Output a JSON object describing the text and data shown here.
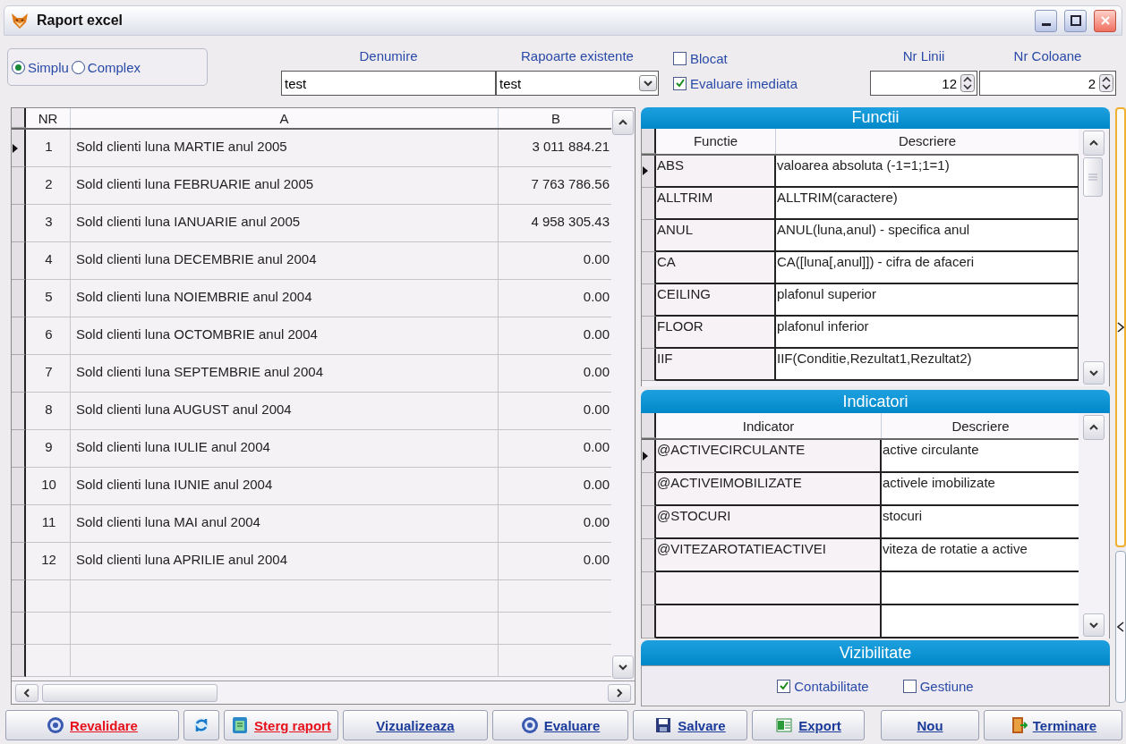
{
  "window": {
    "title": "Raport excel"
  },
  "mode": [
    {
      "label": "Simplu",
      "selected": true
    },
    {
      "label": "Complex",
      "selected": false
    }
  ],
  "fields": [
    {
      "label": "Denumire",
      "value": "test",
      "kind": "text"
    },
    {
      "label": "Rapoarte existente",
      "value": "test",
      "kind": "combo"
    }
  ],
  "options": [
    {
      "label": "Blocat",
      "checked": false
    },
    {
      "label": "Evaluare imediata",
      "checked": true
    }
  ],
  "spinners": [
    {
      "label": "Nr Linii",
      "value": "12"
    },
    {
      "label": "Nr Coloane",
      "value": "2"
    }
  ],
  "report_grid": {
    "columns": [
      "NR",
      "A",
      "B"
    ],
    "rows": [
      {
        "cells": [
          "1",
          "Sold clienti luna MARTIE anul 2005",
          "3 011 884.21"
        ],
        "current": true
      },
      {
        "cells": [
          "2",
          "Sold clienti luna FEBRUARIE anul 2005",
          "7 763 786.56"
        ],
        "current": false
      },
      {
        "cells": [
          "3",
          "Sold clienti luna IANUARIE anul 2005",
          "4 958 305.43"
        ],
        "current": false
      },
      {
        "cells": [
          "4",
          "Sold clienti luna DECEMBRIE anul 2004",
          "0.00"
        ],
        "current": false
      },
      {
        "cells": [
          "5",
          "Sold clienti luna NOIEMBRIE anul 2004",
          "0.00"
        ],
        "current": false
      },
      {
        "cells": [
          "6",
          "Sold clienti luna OCTOMBRIE anul 2004",
          "0.00"
        ],
        "current": false
      },
      {
        "cells": [
          "7",
          "Sold clienti luna SEPTEMBRIE anul 2004",
          "0.00"
        ],
        "current": false
      },
      {
        "cells": [
          "8",
          "Sold clienti luna AUGUST anul 2004",
          "0.00"
        ],
        "current": false
      },
      {
        "cells": [
          "9",
          "Sold clienti luna IULIE anul 2004",
          "0.00"
        ],
        "current": false
      },
      {
        "cells": [
          "10",
          "Sold clienti luna IUNIE anul 2004",
          "0.00"
        ],
        "current": false
      },
      {
        "cells": [
          "11",
          "Sold clienti luna MAI anul 2004",
          "0.00"
        ],
        "current": false
      },
      {
        "cells": [
          "12",
          "Sold clienti luna APRILIE anul 2004",
          "0.00"
        ],
        "current": false
      }
    ]
  },
  "functions": {
    "title": "Functii",
    "columns": [
      "Functie",
      "Descriere"
    ],
    "rows": [
      {
        "cells": [
          "ABS",
          "valoarea absoluta (-1=1;1=1)"
        ],
        "current": true
      },
      {
        "cells": [
          "ALLTRIM",
          "ALLTRIM(caractere)"
        ],
        "current": false
      },
      {
        "cells": [
          "ANUL",
          "ANUL(luna,anul) - specifica anul"
        ],
        "current": false
      },
      {
        "cells": [
          "CA",
          "CA([luna[,anul]]) - cifra de afaceri"
        ],
        "current": false
      },
      {
        "cells": [
          "CEILING",
          "plafonul superior"
        ],
        "current": false
      },
      {
        "cells": [
          "FLOOR",
          "plafonul inferior"
        ],
        "current": false
      },
      {
        "cells": [
          "IIF",
          "IIF(Conditie,Rezultat1,Rezultat2)"
        ],
        "current": false
      }
    ]
  },
  "indicators": {
    "title": "Indicatori",
    "columns": [
      "Indicator",
      "Descriere"
    ],
    "rows": [
      {
        "cells": [
          "@ACTIVECIRCULANTE",
          "active circulante"
        ],
        "current": true
      },
      {
        "cells": [
          "@ACTIVEIMOBILIZATE",
          "activele imobilizate"
        ],
        "current": false
      },
      {
        "cells": [
          "@STOCURI",
          "stocuri"
        ],
        "current": false
      },
      {
        "cells": [
          "@VITEZAROTATIEACTIVEI",
          "viteza de rotatie a active"
        ],
        "current": false
      }
    ]
  },
  "visibility": {
    "title": "Vizibilitate",
    "options": [
      {
        "label": "Contabilitate",
        "checked": true
      },
      {
        "label": "Gestiune",
        "checked": false
      }
    ]
  },
  "buttons": [
    {
      "label": "Revalidare",
      "kind": "gear",
      "danger": true
    },
    {
      "kind": "refresh"
    },
    {
      "label": "Sterg raport",
      "kind": "trash",
      "danger": true
    },
    {
      "label": "Vizualizeaza",
      "kind": "plain",
      "danger": false
    },
    {
      "label": "Evaluare",
      "kind": "gear",
      "danger": false
    },
    {
      "label": "Salvare",
      "kind": "save",
      "danger": false
    },
    {
      "label": "Export",
      "kind": "sheet",
      "danger": false
    },
    {
      "label": "Nou",
      "kind": "plain",
      "danger": false
    },
    {
      "label": "Terminare",
      "kind": "door",
      "danger": false
    }
  ]
}
